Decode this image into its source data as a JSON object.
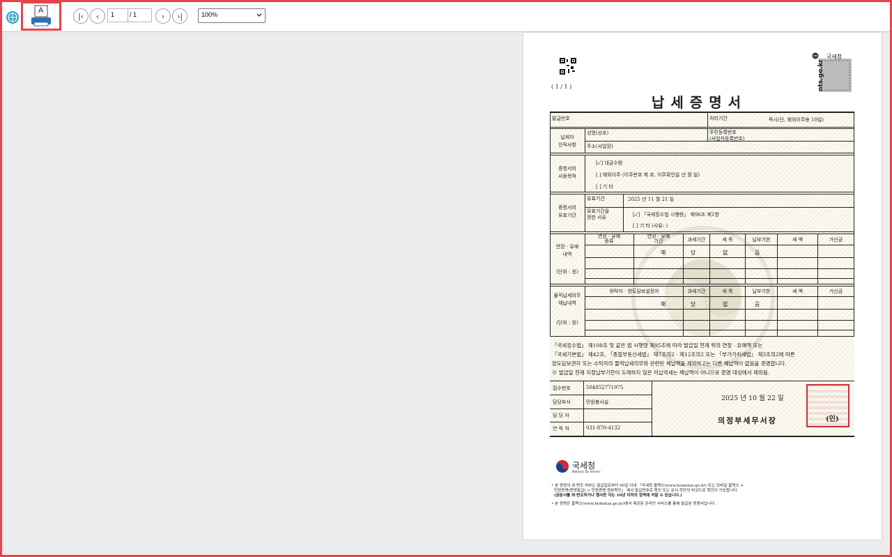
{
  "toolbar": {
    "page_current": "1",
    "page_total": "/ 1",
    "zoom": "100%",
    "print_label": "A"
  },
  "document": {
    "page_indicator": "( 1 / 1 )",
    "site_url": "nts.go.kr",
    "agency_header": "국세청",
    "title": "납세증명서",
    "issue_no_label": "발급번호",
    "processing_period_label": "처리기간",
    "processing_period_value": "즉시(단, 해외이주용 10일)",
    "taxpayer_label": "납세자\n인적사항",
    "name_label": "성명(상호)",
    "rrn_label": "주민등록번호\n(사업자등록번호)",
    "address_label": "주소(사업장)",
    "purpose_label": "증명서의\n사용목적",
    "purpose_options": [
      "[✓]  대금수령",
      "[ ]  해외이주    (이주번호 제                 호, 이주확인일           년    월    일)",
      "[ ]  기  타"
    ],
    "validity_label": "증명서의\n유효기간",
    "validity_period_label": "유효기간",
    "validity_date": "2025 년  11 월  21 일",
    "validity_reason_label": "유효기간을\n정한 사유",
    "validity_reasons": [
      "[✓]  「국세징수법 시행령」 제96조 제1항",
      "[ ]  기  타  (사유:                        )"
    ],
    "deferral_label": "연장 · 유예\n내역",
    "unit_label": "(단위 : 원)",
    "deferral_headers": [
      "연장 · 유예\n종류",
      "연장 · 유예\n기간",
      "과세기간",
      "세 목",
      "납부기한",
      "세 액",
      "가산금"
    ],
    "none_chars": [
      "해",
      "당",
      "없",
      "음"
    ],
    "trust_label": "물적납세의무\n체납내역",
    "trust_headers": [
      "위탁자 · 양도담보설정자",
      "과세기간",
      "세 목",
      "납부기한",
      "세 액",
      "가산금"
    ],
    "body_text": [
      "「국세징수법」 제108조 및 같은 법 시행령 제95조에 따라 발급일 현재 위의 연장 · 유예액 또는",
      "「국세기본법」 제42조, 「종합부동산세법」 제7조의2 · 제12조의2 또는 「부가가치세법」 제3조의2에 따른",
      "양도담보권자 또는 수탁자의 물적납세의무와 관련된 체납액을 제외하고는 다른 체납액이 없음을 증명합니다.",
      "※ 발급일 현재 지정납부기한이 도래하지 않은 미납국세는 체납액이 아니므로 증명 대상에서 제외됨."
    ],
    "receipt_no_label": "접수번호",
    "receipt_no": "504852771975",
    "dept_label": "담당부서",
    "dept": "민원봉사실",
    "officer_label": "담 당 자",
    "contact_label": "연 락 처",
    "contact": "031-870-4132",
    "issue_date": "2025 년  10 월  22 일",
    "issuer": "의정부세무서장",
    "seal_label": "(인)",
    "footer_logo_ko": "국세청",
    "footer_logo_en": "National Tax Service",
    "notes": [
      "• 본 증명의 위·변조 여부는 발급일로부터 90일 이내 「국세청 홈택스(www.hometax.go.kr) 또는 모바일 홈택스 >",
      "민원증명(증명발급) > 민원증명 원본확인」 에서 발급번호로 확인 또는 문서 하단의 바코드로 확인이 가능합니다.",
      "(공문서를 위·변조하거나 행사한 자는 10년 이하의 징역에 처할 수 있습니다.)",
      "• 본 증명은 홈택스(www.hometax.go.kr)에서 제공된 온라인 서비스를 통해 발급된 증명서입니다."
    ]
  }
}
